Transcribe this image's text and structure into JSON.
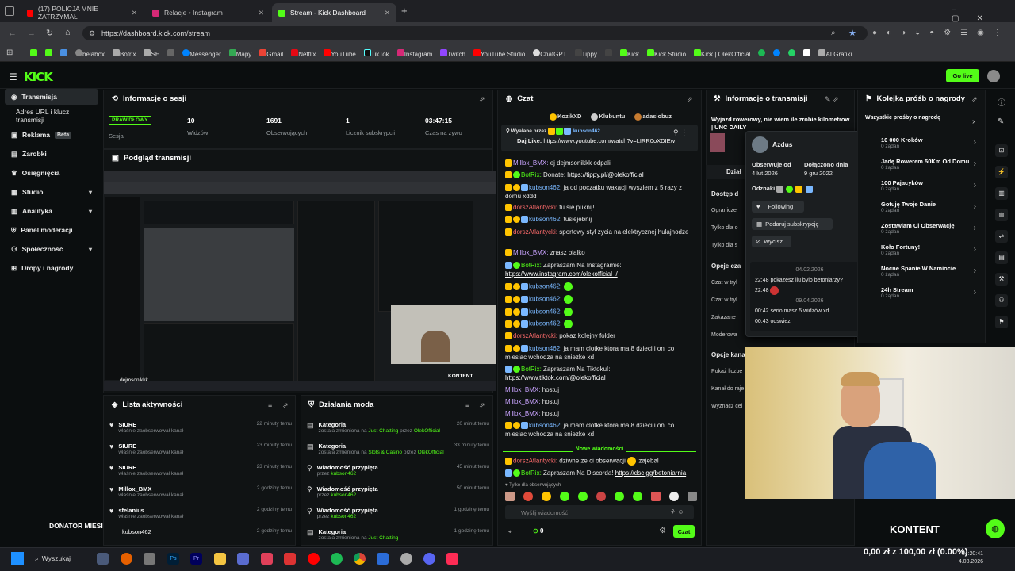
{
  "browser": {
    "tabs": [
      {
        "label": "(17) POLICJA MNIE ZATRZYMAŁ"
      },
      {
        "label": "Relacje • Instagram"
      },
      {
        "label": "Stream - Kick Dashboard"
      }
    ],
    "url": "https://dashboard.kick.com/stream",
    "bookmarks": [
      "belabox",
      "Botrix",
      "SE",
      "Messenger",
      "Mapy",
      "Gmail",
      "Netflix",
      "YouTube",
      "TikTok",
      "Instagram",
      "Twitch",
      "YouTube Studio",
      "ChatGPT",
      "Tippy",
      "Kick",
      "Kick Studio",
      "Kick | OlekOfficial",
      "AI Grafiki"
    ]
  },
  "header": {
    "logo": "KICK",
    "go_live": "Go live"
  },
  "sidebar": {
    "items": [
      {
        "label": "Transmisja"
      },
      {
        "label": "Adres URL i klucz transmisji"
      },
      {
        "label": "Reklama",
        "badge": "Beta"
      },
      {
        "label": "Zarobki"
      },
      {
        "label": "Osiągnięcia"
      },
      {
        "label": "Studio"
      },
      {
        "label": "Analityka"
      },
      {
        "label": "Panel moderacji"
      },
      {
        "label": "Społeczność"
      },
      {
        "label": "Dropy i nagrody"
      }
    ]
  },
  "session": {
    "title": "Informacje o sesji",
    "status": "PRAWIDŁOWY",
    "status_label": "Sesja",
    "stats": [
      {
        "value": "10",
        "label": "Widzów"
      },
      {
        "value": "1691",
        "label": "Obserwujących"
      },
      {
        "value": "1",
        "label": "Licznik subskrypcji"
      },
      {
        "value": "03:47:15",
        "label": "Czas na żywo"
      }
    ]
  },
  "preview": {
    "title": "Podgląd transmisji",
    "overlay_name": "dejmsonikkk",
    "overlay_label": "KONTENT"
  },
  "activity": {
    "title": "Lista aktywności",
    "items": [
      {
        "name": "SIURE",
        "action": "właśnie zaobserwował kanał",
        "time": "22 minuty temu"
      },
      {
        "name": "SIURE",
        "action": "właśnie zaobserwował kanał",
        "time": "23 minuty temu"
      },
      {
        "name": "SIURE",
        "action": "właśnie zaobserwował kanał",
        "time": "23 minuty temu"
      },
      {
        "name": "Millox_BMX",
        "action": "właśnie zaobserwował kanał",
        "time": "2 godziny temu"
      },
      {
        "name": "sfelanius",
        "action": "właśnie zaobserwował kanał",
        "time": "2 godziny temu"
      },
      {
        "name": "kubson462",
        "action": "",
        "time": "2 godziny temu"
      }
    ]
  },
  "donator": "DONATOR MIESIĄCA",
  "mods": {
    "title": "Działania moda",
    "items": [
      {
        "title": "Kategoria",
        "desc_pre": "została zmieniona na",
        "value": "Just Chatting",
        "by": "OlekOfficial",
        "time": "20 minut temu"
      },
      {
        "title": "Kategoria",
        "desc_pre": "została zmieniona na",
        "value": "Slots & Casino",
        "by": "OlekOfficial",
        "time": "33 minuty temu"
      },
      {
        "title": "Wiadomość przypięta",
        "desc_pre": "przez",
        "value": "kubson462",
        "by": "",
        "time": "45 minut temu"
      },
      {
        "title": "Wiadomość przypięta",
        "desc_pre": "przez",
        "value": "kubson462",
        "by": "",
        "time": "50 minut temu"
      },
      {
        "title": "Wiadomość przypięta",
        "desc_pre": "przez",
        "value": "kubson462",
        "by": "",
        "time": "1 godzinę temu"
      },
      {
        "title": "Kategoria",
        "desc_pre": "została zmieniona na",
        "value": "Just Chatting",
        "by": "",
        "time": "1 godzinę temu"
      }
    ]
  },
  "chat": {
    "title": "Czat",
    "top_users": [
      "KozikXD",
      "Klubuntu",
      "adasiobuz"
    ],
    "pinned_by": "Wyalane przez",
    "pinned_user": "kubson462",
    "pinned_msg": "Daj Like:",
    "pinned_link": "https://www.youtube.com/watch?v=LIRR0oXDIEw",
    "messages": [
      {
        "user": "Millox_BMX:",
        "cls": "purple",
        "text": "ej dejmsonikkk odpalil",
        "link": ""
      },
      {
        "user": "BotRix:",
        "cls": "green",
        "text": "Donate:",
        "link": "https://tippy.pl/@olekofficial"
      },
      {
        "user": "kubson462:",
        "cls": "blue",
        "text": "ja od poczatku wakacji wyszlem z 5 razy z",
        "link": ""
      },
      {
        "user": "",
        "cls": "",
        "text": "domu xddd",
        "link": ""
      },
      {
        "user": "dorszAtlantycki:",
        "cls": "red",
        "text": "tu sie puknij!",
        "link": ""
      },
      {
        "user": "kubson462:",
        "cls": "blue",
        "text": "tusiejebnij",
        "link": ""
      },
      {
        "user": "dorszAtlantycki:",
        "cls": "red",
        "text": "sportowy styl zycia na elektrycznej hulajnodze",
        "link": ""
      },
      {
        "user": "Millox_BMX:",
        "cls": "purple",
        "text": "znasz bialko",
        "link": ""
      },
      {
        "user": "BotRix:",
        "cls": "green",
        "text": "Zapraszam Na Instagramie:",
        "link": ""
      },
      {
        "user": "",
        "cls": "",
        "text": "",
        "link": "https://www.instagram.com/olekofficial_/"
      },
      {
        "user": "kubson462:",
        "cls": "blue",
        "text": "",
        "link": ""
      },
      {
        "user": "kubson462:",
        "cls": "blue",
        "text": "",
        "link": ""
      },
      {
        "user": "kubson462:",
        "cls": "blue",
        "text": "",
        "link": ""
      },
      {
        "user": "kubson462:",
        "cls": "blue",
        "text": "",
        "link": ""
      },
      {
        "user": "dorszAtlantycki:",
        "cls": "red",
        "text": "pokaz kolejny folder",
        "link": ""
      },
      {
        "user": "kubson462:",
        "cls": "blue",
        "text": "ja mam clotke ktora ma 8 dzieci i oni co",
        "link": ""
      },
      {
        "user": "",
        "cls": "",
        "text": "miesiac wchodza na sniezke xd",
        "link": ""
      },
      {
        "user": "BotRix:",
        "cls": "green",
        "text": "Zapraszam Na Tiktoku!:",
        "link": ""
      },
      {
        "user": "",
        "cls": "",
        "text": "",
        "link": "https://www.tiktok.com/@olekofficial"
      },
      {
        "user": "Millox_BMX:",
        "cls": "purple",
        "text": "hostuj",
        "link": ""
      },
      {
        "user": "Millox_BMX:",
        "cls": "purple",
        "text": "hostuj",
        "link": ""
      },
      {
        "user": "Millox_BMX:",
        "cls": "purple",
        "text": "hostuj",
        "link": ""
      },
      {
        "user": "kubson462:",
        "cls": "blue",
        "text": "ja mam clotke ktora ma 8 dzieci i oni co",
        "link": ""
      },
      {
        "user": "",
        "cls": "",
        "text": "miesiac wchodza na sniezke xd",
        "link": ""
      }
    ],
    "new_messages": "Nowe wiadomości",
    "after": [
      {
        "user": "dorszAtlantycki:",
        "cls": "red",
        "text": "dziwne ze ci obserwacji",
        "tail": "zajebal",
        "link": ""
      },
      {
        "user": "BotRix:",
        "cls": "green",
        "text": "Zapraszam Na Discorda!",
        "tail": "",
        "link": "https://dsc.gg/betoniarnia"
      }
    ],
    "followers_only": "Tylko dla obserwujących",
    "input_placeholder": "Wyślij wiadomość",
    "points": "0",
    "send": "Czat"
  },
  "stream_info": {
    "title": "Informacje o transmisji",
    "stream_title": "Wyjazd rowerowy, nie wiem ile zrobie kilometrow | UNC DAILY",
    "section": "Dział",
    "rows": [
      "Dostęp d",
      "Ograniczer",
      "Tylko dla o",
      "Tylko dla s"
    ],
    "opts_title": "Opcje cza",
    "opts": [
      "Czat w tryl",
      "Czat w tryl",
      "Zakazane",
      "Moderowa"
    ],
    "chan_title": "Opcje kana",
    "chan": [
      "Pokaż liczbę",
      "Kanał do raje",
      "Wyznacz cel"
    ]
  },
  "popup": {
    "name": "Azdus",
    "follows_label": "Obserwuje od",
    "follows": "4 lut 2026",
    "joined_label": "Dołączono dnia",
    "joined": "9 gru 2022",
    "badges_label": "Odznaki",
    "following": "Following",
    "gift": "Podaruj subskrypcję",
    "clear": "Wycisz",
    "history": [
      {
        "date": "04.02.2026",
        "lines": [
          "22:48 pokazesz ilu bylo betoniarzy?",
          "22:48"
        ]
      },
      {
        "date": "09.04.2026",
        "lines": [
          "00:42 serio masz 5 widzów xd",
          "00:43 odswiez"
        ]
      }
    ]
  },
  "rewards": {
    "title": "Kolejka próśb o nagrody",
    "all": "Wszystkie prośby o nagrodę",
    "items": [
      {
        "name": "10 000 Kroków",
        "count": "0 żądań"
      },
      {
        "name": "Jadę Rowerem 50Km Od Domu",
        "count": "0 żądań"
      },
      {
        "name": "100 Pajacyków",
        "count": "0 żądań"
      },
      {
        "name": "Gotuję Twoje Danie",
        "count": "0 żądań"
      },
      {
        "name": "Zostawiam Ci Obserwację",
        "count": "0 żądań"
      },
      {
        "name": "Koło Fortuny!",
        "count": "0 żądań"
      },
      {
        "name": "Nocne Spanie W Namiocie",
        "count": "0 żądań"
      },
      {
        "name": "24h Stream",
        "count": "0 żądań"
      }
    ]
  },
  "cam_label": "KONTENT",
  "taskbar": {
    "search": "Wyszukaj",
    "ticker": "0,00 zł z 100,00 zł (0.00%)",
    "time": "14:20:41",
    "date": "4.08.2026"
  },
  "colors": {
    "accent": "#53fc18",
    "bg": "#0b0e0f",
    "panel": "#101314"
  }
}
